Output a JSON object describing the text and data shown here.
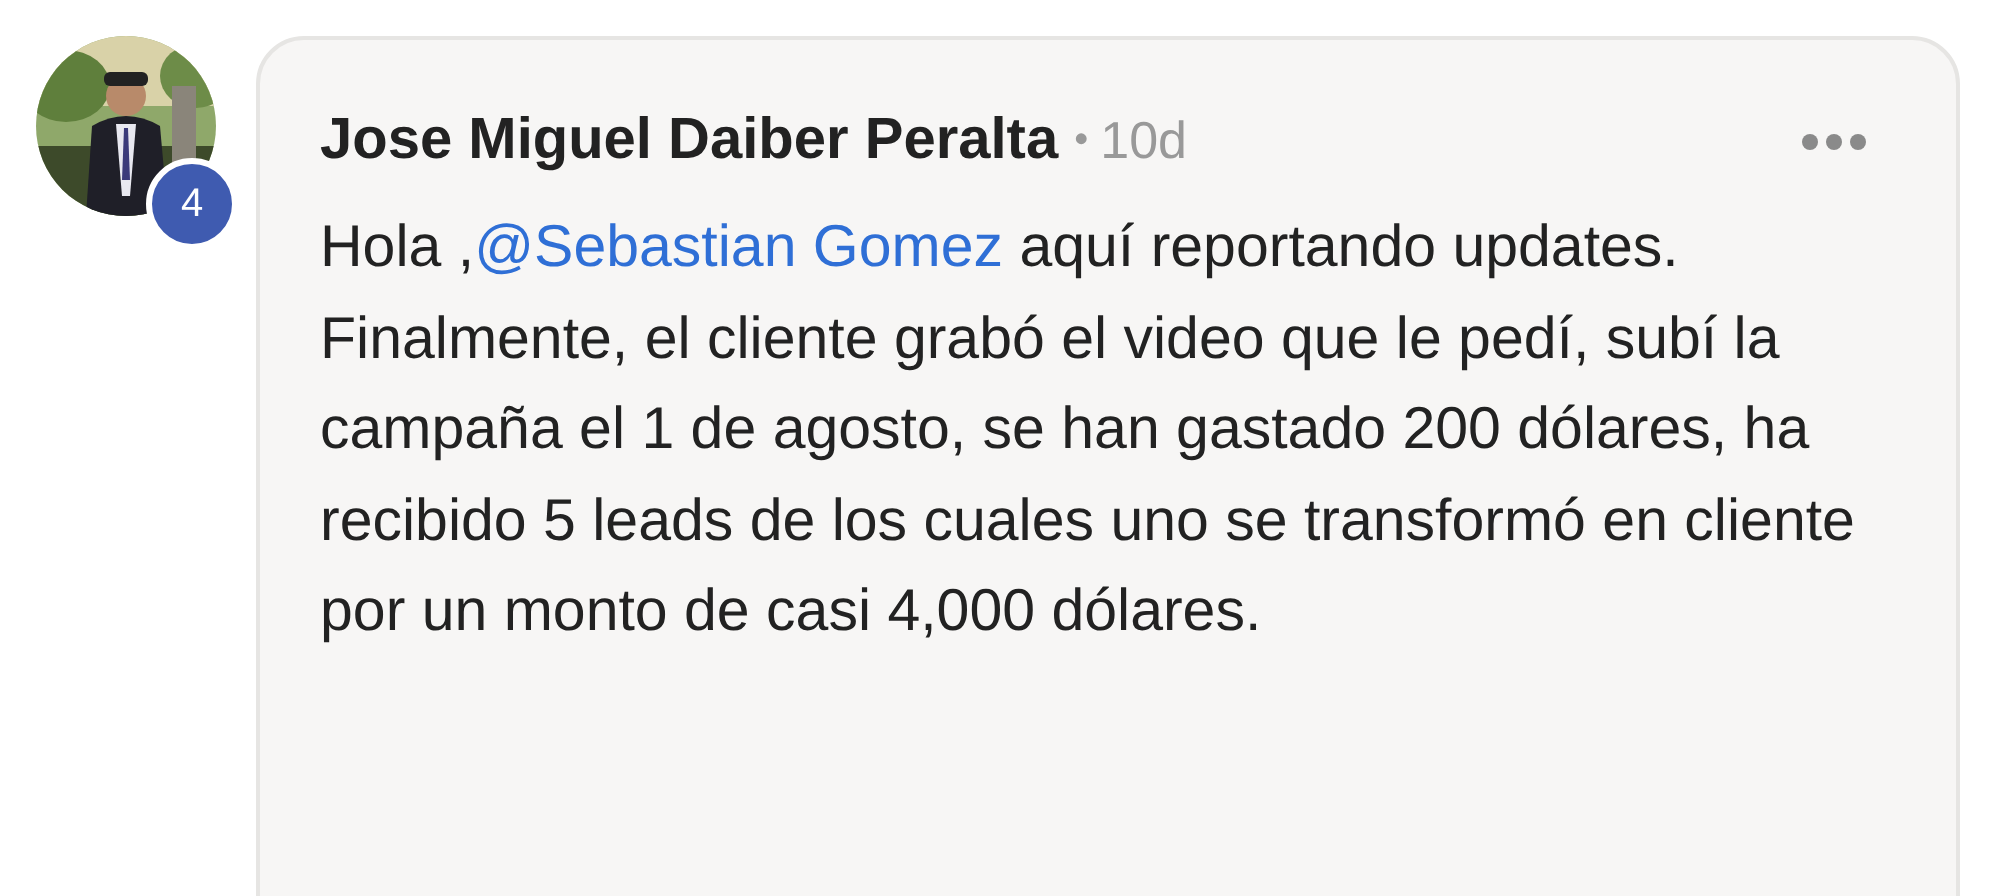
{
  "comment": {
    "author": {
      "name": "Jose Miguel Daiber Peralta",
      "badge": "4"
    },
    "separator": "•",
    "time": "10d",
    "body": {
      "before": "Hola ,",
      "mention": "@Sebastian Gomez",
      "after": " aquí reportando updates. Finalmente, el cliente grabó el video que le pedí, subí la campaña el 1 de agosto, se han gastado 200 dólares, ha recibido 5 leads de los cuales uno se transformó en cliente por un monto de casi 4,000 dólares."
    }
  }
}
